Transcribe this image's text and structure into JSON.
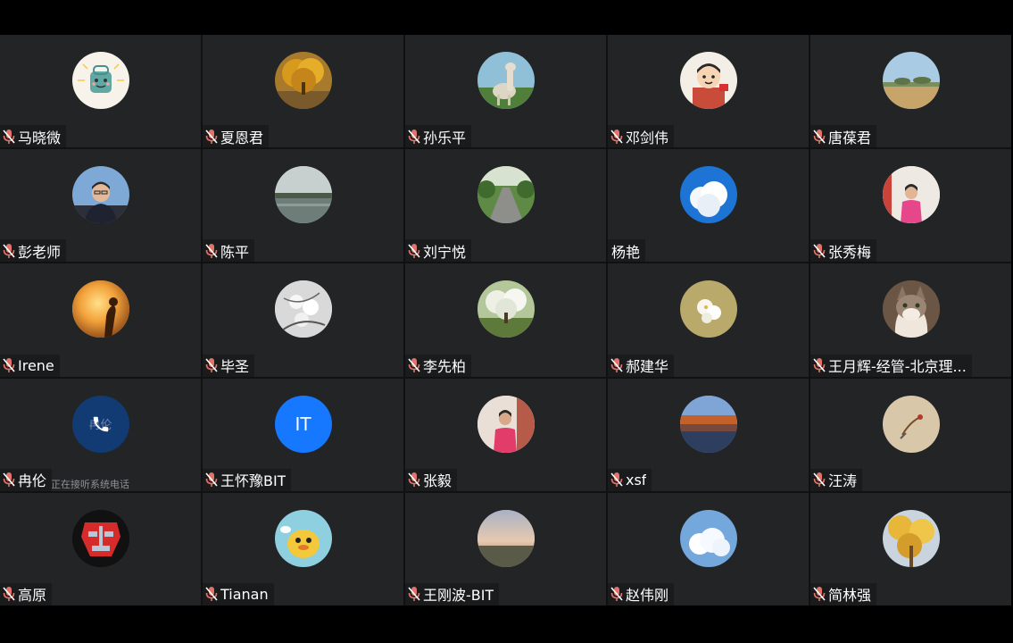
{
  "meeting": {
    "participants": [
      {
        "name": "马晓微",
        "avatar": "cartoon-bag",
        "muted": true
      },
      {
        "name": "夏恩君",
        "avatar": "golden-tree",
        "muted": true
      },
      {
        "name": "孙乐平",
        "avatar": "alpaca",
        "muted": true
      },
      {
        "name": "邓剑伟",
        "avatar": "cartoon-boy",
        "muted": true
      },
      {
        "name": "唐葆君",
        "avatar": "landscape-field",
        "muted": true
      },
      {
        "name": "彭老师",
        "avatar": "man-portrait",
        "muted": true
      },
      {
        "name": "陈平",
        "avatar": "lake-sunset",
        "muted": true
      },
      {
        "name": "刘宁悦",
        "avatar": "park-road",
        "muted": true
      },
      {
        "name": "杨艳",
        "avatar": "clouds-sky",
        "muted": false
      },
      {
        "name": "张秀梅",
        "avatar": "woman-pink",
        "muted": true
      },
      {
        "name": "Irene",
        "avatar": "sunset-silhouette",
        "muted": true
      },
      {
        "name": "毕圣",
        "avatar": "bw-flowers",
        "muted": true
      },
      {
        "name": "李先柏",
        "avatar": "blossom-tree",
        "muted": true
      },
      {
        "name": "郝建华",
        "avatar": "white-flowers",
        "muted": true
      },
      {
        "name": "王月辉-经管-北京理...",
        "avatar": "cat",
        "muted": true
      },
      {
        "name": "冉伦",
        "avatar": "phone-call",
        "avatar_text": "冉伦",
        "muted": true,
        "status": "正在接听系统电话"
      },
      {
        "name": "王怀豫BIT",
        "avatar": "initials",
        "avatar_text": "IT",
        "muted": true
      },
      {
        "name": "张毅",
        "avatar": "woman-red",
        "muted": true
      },
      {
        "name": "xsf",
        "avatar": "autumn-reflection",
        "muted": true
      },
      {
        "name": "汪涛",
        "avatar": "beige-sketch",
        "muted": true
      },
      {
        "name": "高原",
        "avatar": "robot-mask",
        "muted": true
      },
      {
        "name": "Tianan",
        "avatar": "yellow-cartoon",
        "muted": true
      },
      {
        "name": "王刚波-BIT",
        "avatar": "horizon-dusk",
        "muted": true
      },
      {
        "name": "赵伟刚",
        "avatar": "blue-clouds",
        "muted": true
      },
      {
        "name": "简林强",
        "avatar": "golden-leaves",
        "muted": true
      }
    ]
  },
  "colors": {
    "background": "#000000",
    "tile": "#232426",
    "name_tag": "#1a1b1d",
    "muted_mic": "#e0746a",
    "initials_avatar": "#1677ff",
    "call_avatar": "#123a73"
  }
}
